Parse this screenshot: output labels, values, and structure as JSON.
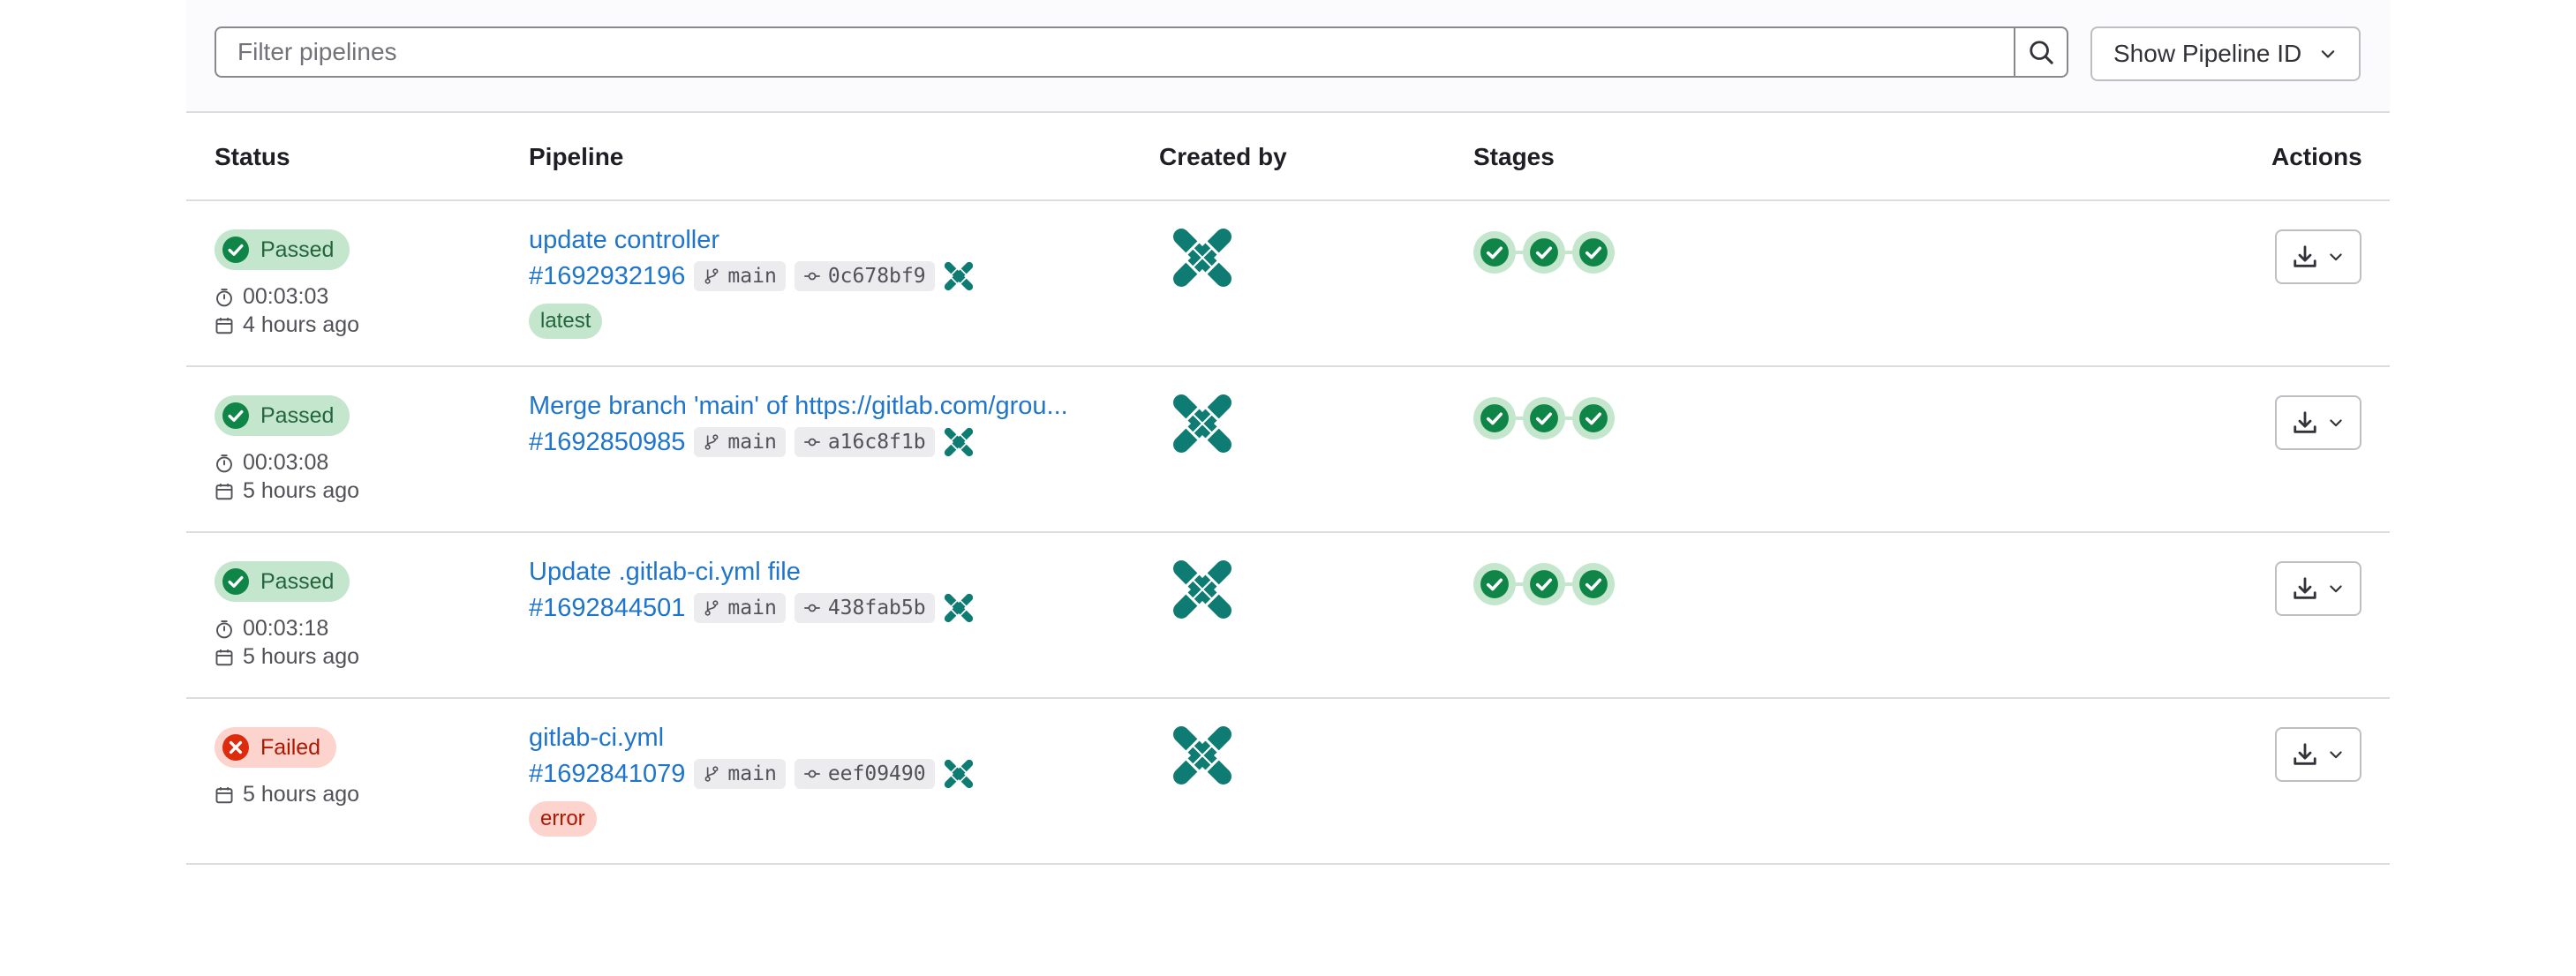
{
  "filter": {
    "placeholder": "Filter pipelines",
    "show_pipeline_id_label": "Show Pipeline ID"
  },
  "table": {
    "headers": {
      "status": "Status",
      "pipeline": "Pipeline",
      "created_by": "Created by",
      "stages": "Stages",
      "actions": "Actions"
    },
    "rows": [
      {
        "status": "Passed",
        "duration": "00:03:03",
        "finished": "4 hours ago",
        "title": "update controller",
        "id": "#1692932196",
        "branch": "main",
        "commit": "0c678bf9",
        "tag": "latest",
        "stages": [
          "passed",
          "passed",
          "passed"
        ]
      },
      {
        "status": "Passed",
        "duration": "00:03:08",
        "finished": "5 hours ago",
        "title": "Merge branch 'main' of https://gitlab.com/grou...",
        "id": "#1692850985",
        "branch": "main",
        "commit": "a16c8f1b",
        "tag": "",
        "stages": [
          "passed",
          "passed",
          "passed"
        ]
      },
      {
        "status": "Passed",
        "duration": "00:03:18",
        "finished": "5 hours ago",
        "title": "Update .gitlab-ci.yml file",
        "id": "#1692844501",
        "branch": "main",
        "commit": "438fab5b",
        "tag": "",
        "stages": [
          "passed",
          "passed",
          "passed"
        ]
      },
      {
        "status": "Failed",
        "duration": "",
        "finished": "5 hours ago",
        "title": "gitlab-ci.yml",
        "id": "#1692841079",
        "branch": "main",
        "commit": "eef09490",
        "tag": "error",
        "stages": []
      }
    ]
  },
  "colors": {
    "link": "#1f75cb",
    "success_bg": "#c3e6cd",
    "success_fg": "#24663b",
    "success_icon": "#108548",
    "danger_bg": "#fdd4cd",
    "danger_fg": "#ae1800",
    "danger_icon": "#dd2b0e",
    "avatar": "#0e7c72"
  },
  "icons": {
    "search": "search-icon",
    "chevron": "chevron-down-icon",
    "status_passed": "status-success-icon",
    "status_failed": "status-failed-icon",
    "duration": "timer-icon",
    "finished": "calendar-icon",
    "branch": "branch-icon",
    "commit": "commit-icon",
    "actions": "download-icon"
  }
}
